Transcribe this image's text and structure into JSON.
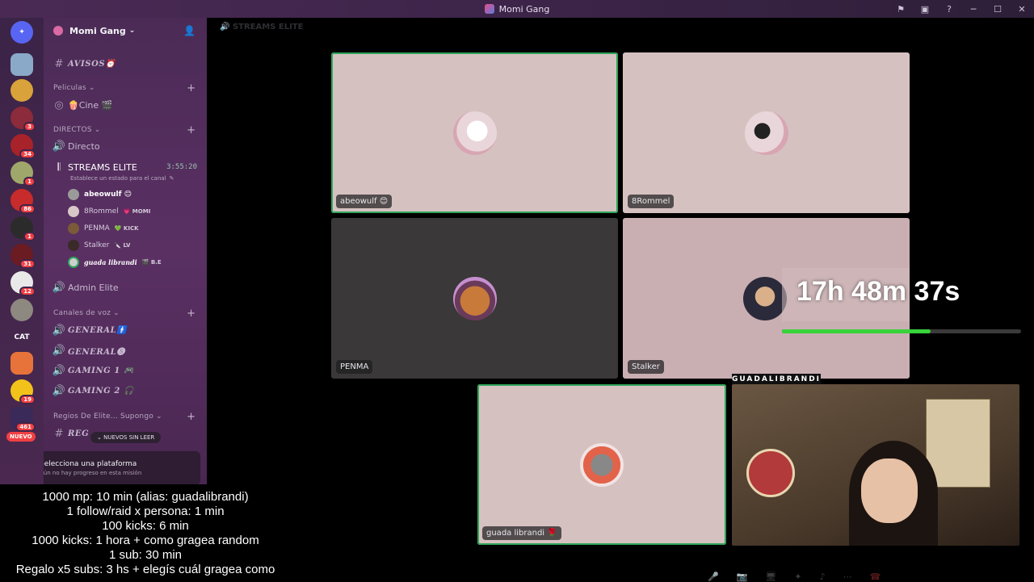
{
  "window": {
    "title": "Momi Gang"
  },
  "server": {
    "name": "Momi Gang"
  },
  "guild_badges": [
    "3",
    "34",
    "1",
    "86",
    "1",
    "31",
    "12",
    "",
    "",
    "",
    "19",
    "461"
  ],
  "guild_cat_label": "CAT",
  "guild_new_label": "NUEVO",
  "channels": {
    "avisos": "AVISOS⏰",
    "cat_peliculas": "Peliculas",
    "cine": "🍿Cine 🎬",
    "cat_directos": "DIRECTOS",
    "directo": "Directo",
    "streams_elite": "STREAMS ELITE",
    "streams_elite_time": "3:55:20",
    "streams_elite_status": "Establece un estado para el canal",
    "admin_elite": "Admin Elite",
    "cat_voz": "Canales de voz",
    "general1": "GENERAL🚹",
    "general2": "GENERAL🅢",
    "gaming1": "GAMING 1 🎮",
    "gaming2": "GAMING 2 🎧",
    "cat_regios": "Regios De Elite... Supongo",
    "regios": "REG",
    "unread_pill": "⌄ NUEVOS SIN LEER"
  },
  "voice_users": [
    {
      "name": "abeowulf 😊",
      "tag": ""
    },
    {
      "name": "8Rommel",
      "tag": "💗 MOMI"
    },
    {
      "name": "PENMA",
      "tag": "💚 KICK"
    },
    {
      "name": "Stalker",
      "tag": "🔪 LV"
    },
    {
      "name": "guada librandi",
      "tag": "🎬 B.E"
    }
  ],
  "mission": {
    "title": "Selecciona una plataforma",
    "subtitle": "Aún no hay progreso en esta misión"
  },
  "main": {
    "channel_header": "STREAMS ELITE"
  },
  "tiles": {
    "abeowulf": "abeowulf 😊",
    "rommel": "8Rommel",
    "penma": "PENMA",
    "stalker": "Stalker",
    "guada": "guada librandi 🌹"
  },
  "stream": {
    "cam_name": "GUADALIBRANDI",
    "timer": "17h 48m 37s",
    "progress_pct": 62,
    "overlay_lines": [
      "1000 mp: 10 min (alias: guadalibrandi)",
      "1 follow/raid x persona: 1 min",
      "100 kicks: 6 min",
      "1000 kicks: 1 hora + como gragea random",
      "1 sub: 30 min",
      "Regalo x5 subs: 3 hs + elegís cuál gragea como"
    ]
  },
  "colors": {
    "accent": "#2fa55a",
    "progress": "#38d33a",
    "sidebar": "#4b2b56"
  }
}
